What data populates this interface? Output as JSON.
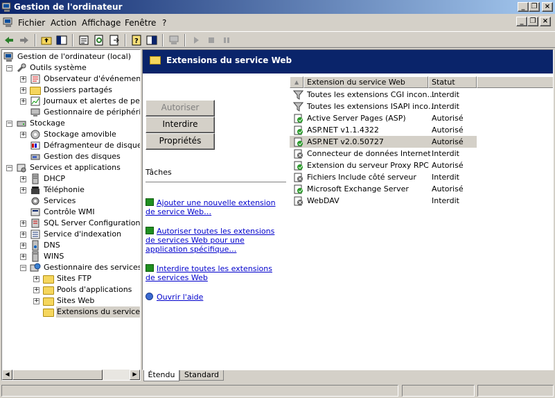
{
  "window": {
    "title": "Gestion de l'ordinateur"
  },
  "menu": [
    "Fichier",
    "Action",
    "Affichage",
    "Fenêtre",
    "?"
  ],
  "tree": {
    "root": "Gestion de l'ordinateur (local)",
    "system_tools": "Outils système",
    "event_viewer": "Observateur d'événements",
    "shared_folders": "Dossiers partagés",
    "perf_logs": "Journaux et alertes de perfo",
    "device_manager": "Gestionnaire de périphérique",
    "storage": "Stockage",
    "removable": "Stockage amovible",
    "defrag": "Défragmenteur de disque",
    "disk_mgmt": "Gestion des disques",
    "services_apps": "Services et applications",
    "dhcp": "DHCP",
    "telephony": "Téléphonie",
    "services": "Services",
    "wmi": "Contrôle WMI",
    "sql": "SQL Server Configuration M",
    "indexing": "Service d'indexation",
    "dns": "DNS",
    "wins": "WINS",
    "iis": "Gestionnaire des services In",
    "ftp": "Sites FTP",
    "apppools": "Pools d'applications",
    "websites": "Sites Web",
    "webext": "Extensions du service W"
  },
  "panel": {
    "title": "Extensions du service Web"
  },
  "actions": {
    "allow": "Autoriser",
    "deny": "Interdire",
    "props": "Propriétés"
  },
  "tasks": {
    "title": "Tâches",
    "add": "Ajouter une nouvelle extension de service Web…",
    "allow_all": "Autoriser toutes les extensions de services Web pour une application spécifique…",
    "deny_all": "Interdire toutes les extensions de services Web",
    "help": "Ouvrir l'aide"
  },
  "list": {
    "col_name": "Extension du service Web",
    "col_status": "Statut",
    "rows": [
      {
        "name": "Toutes les extensions CGI incon…",
        "status": "Interdit",
        "icon": "filter-icon"
      },
      {
        "name": "Toutes les extensions ISAPI inco…",
        "status": "Interdit",
        "icon": "filter-icon"
      },
      {
        "name": "Active Server Pages (ASP)",
        "status": "Autorisé",
        "icon": "allowed-icon"
      },
      {
        "name": "ASP.NET v1.1.4322",
        "status": "Autorisé",
        "icon": "allowed-icon"
      },
      {
        "name": "ASP.NET v2.0.50727",
        "status": "Autorisé",
        "icon": "allowed-icon"
      },
      {
        "name": "Connecteur de données Internet",
        "status": "Interdit",
        "icon": "denied-icon"
      },
      {
        "name": "Extension du serveur Proxy RPC",
        "status": "Autorisé",
        "icon": "allowed-icon"
      },
      {
        "name": "Fichiers Include côté serveur",
        "status": "Interdit",
        "icon": "denied-icon"
      },
      {
        "name": "Microsoft Exchange Server",
        "status": "Autorisé",
        "icon": "allowed-icon"
      },
      {
        "name": "WebDAV",
        "status": "Interdit",
        "icon": "denied-icon"
      }
    ]
  },
  "view_tabs": [
    "Étendu",
    "Standard"
  ],
  "colors": {
    "title_start": "#0a246a",
    "title_end": "#a6caf0",
    "panel_header": "#0a246a",
    "link": "#0000cc"
  }
}
